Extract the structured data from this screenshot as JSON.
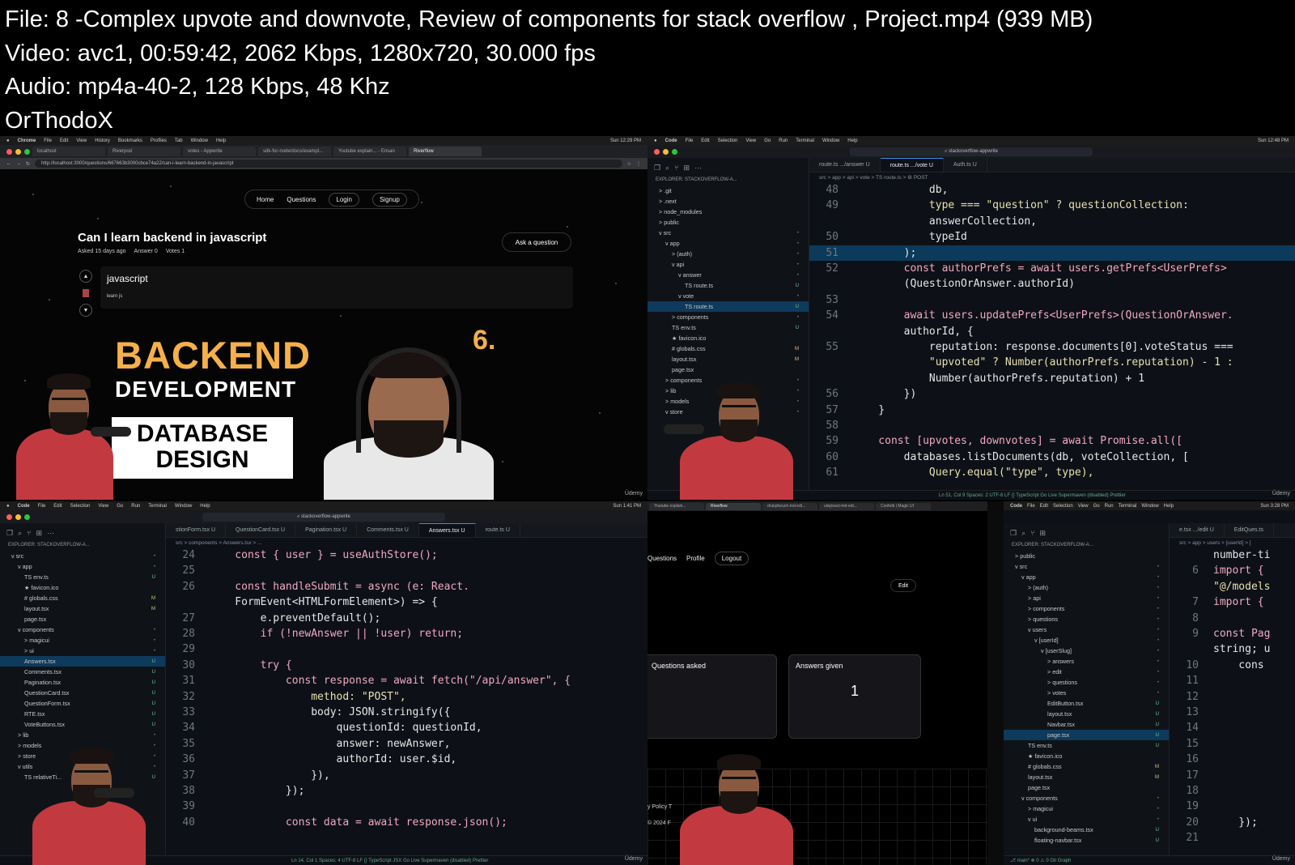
{
  "header": {
    "line1": "File: 8 -Complex upvote and downvote, Review of components for stack overflow , Project.mp4 (939 MB)",
    "line2": "Video: avc1, 00:59:42, 2062 Kbps, 1280x720, 30.000 fps",
    "line3": "Audio: mp4a-40-2, 128 Kbps, 48 Khz",
    "line4": "OrThodoX"
  },
  "watermark": "Ûdemy",
  "q1": {
    "menubar": [
      "Chrome",
      "File",
      "Edit",
      "View",
      "History",
      "Bookmarks",
      "Profiles",
      "Tab",
      "Window",
      "Help"
    ],
    "clock": "Sun 12:29 PM",
    "tabs": [
      "localhost",
      "Riverpod",
      "votes - Appwrite",
      "sdk-for-node/docs/exampl...",
      "Youtube explain... - Ensan",
      "Riverflow"
    ],
    "url": "http://localhost:3000/questions/667663b3000cbce74a22/can-i-learn-backend-in-javascript",
    "nav": {
      "home": "Home",
      "questions": "Questions",
      "login": "Login",
      "signup": "Signup"
    },
    "question_title": "Can I learn backend in javascript",
    "meta": {
      "asked": "Asked 15 days ago",
      "answers": "Answer 0",
      "votes": "Votes 1"
    },
    "ask_button": "Ask a question",
    "answer_title": "javascript",
    "answer_body": "learn js",
    "thumb": {
      "backend": "BACKEND",
      "development": "DEVELOPMENT",
      "database": "DATABASE",
      "design": "DESIGN",
      "number": "6."
    }
  },
  "q2": {
    "menubar": [
      "Code",
      "File",
      "Edit",
      "Selection",
      "View",
      "Go",
      "Run",
      "Terminal",
      "Window",
      "Help"
    ],
    "clock": "Sun 12:48 PM",
    "search": "stackoverflow-appwrite",
    "explorer": "EXPLORER: STACKOVERFLOW-A...",
    "tabs": [
      "route.ts .../answer U",
      "route.ts .../vote U",
      "Auth.ts U"
    ],
    "breadcrumb": "src > app > api > vote > TS route.ts > ⚙ POST",
    "tree": [
      {
        "label": "> .git",
        "indent": 1,
        "status": ""
      },
      {
        "label": "> .next",
        "indent": 1,
        "status": ""
      },
      {
        "label": "> node_modules",
        "indent": 1,
        "status": ""
      },
      {
        "label": "> public",
        "indent": 1,
        "status": ""
      },
      {
        "label": "v src",
        "indent": 1,
        "status": "•"
      },
      {
        "label": "v app",
        "indent": 2,
        "status": "•"
      },
      {
        "label": "> (auth)",
        "indent": 3,
        "status": "•"
      },
      {
        "label": "v api",
        "indent": 3,
        "status": "•"
      },
      {
        "label": "v answer",
        "indent": 4,
        "status": "•"
      },
      {
        "label": "TS route.ts",
        "indent": 5,
        "status": "U"
      },
      {
        "label": "v vote",
        "indent": 4,
        "status": "•"
      },
      {
        "label": "TS route.ts",
        "indent": 5,
        "status": "U",
        "selected": true
      },
      {
        "label": "> components",
        "indent": 3,
        "status": "•"
      },
      {
        "label": "TS env.ts",
        "indent": 3,
        "status": "U"
      },
      {
        "label": "★ favicon.ico",
        "indent": 3,
        "status": ""
      },
      {
        "label": "# globals.css",
        "indent": 3,
        "status": "M"
      },
      {
        "label": "layout.tsx",
        "indent": 3,
        "status": "M"
      },
      {
        "label": "page.tsx",
        "indent": 3,
        "status": ""
      },
      {
        "label": "> components",
        "indent": 2,
        "status": "•"
      },
      {
        "label": "> lib",
        "indent": 2,
        "status": "•"
      },
      {
        "label": "> models",
        "indent": 2,
        "status": "•"
      },
      {
        "label": "v store",
        "indent": 2,
        "status": "•"
      }
    ],
    "lines": [
      {
        "n": "48",
        "t": "            db,"
      },
      {
        "n": "49",
        "t": "            type === \"question\" ? questionCollection:"
      },
      {
        "n": "",
        "t": "            answerCollection,"
      },
      {
        "n": "50",
        "t": "            typeId"
      },
      {
        "n": "51",
        "t": "        );",
        "hl": true
      },
      {
        "n": "52",
        "t": "        const authorPrefs = await users.getPrefs<UserPrefs>"
      },
      {
        "n": "",
        "t": "        (QuestionOrAnswer.authorId)"
      },
      {
        "n": "53",
        "t": ""
      },
      {
        "n": "54",
        "t": "        await users.updatePrefs<UserPrefs>(QuestionOrAnswer."
      },
      {
        "n": "",
        "t": "        authorId, {"
      },
      {
        "n": "55",
        "t": "            reputation: response.documents[0].voteStatus ==="
      },
      {
        "n": "",
        "t": "            \"upvoted\" ? Number(authorPrefs.reputation) - 1 :"
      },
      {
        "n": "",
        "t": "            Number(authorPrefs.reputation) + 1"
      },
      {
        "n": "56",
        "t": "        })"
      },
      {
        "n": "57",
        "t": "    }"
      },
      {
        "n": "58",
        "t": ""
      },
      {
        "n": "59",
        "t": "    const [upvotes, downvotes] = await Promise.all(["
      },
      {
        "n": "60",
        "t": "        databases.listDocuments(db, voteCollection, ["
      },
      {
        "n": "61",
        "t": "            Query.equal(\"type\", type),"
      }
    ],
    "status": "Ln 51, Col 9   Spaces: 2   UTF-8   LF   {} TypeScript   Go Live   Supermaven (disabled)   Prettier"
  },
  "q3": {
    "menubar": [
      "Code",
      "File",
      "Edit",
      "Selection",
      "View",
      "Go",
      "Run",
      "Terminal",
      "Window",
      "Help"
    ],
    "clock": "Sun 1:41 PM",
    "search": "stackoverflow-appwrite",
    "explorer": "EXPLORER: STACKOVERFLOW-A...",
    "tabs": [
      "stionForm.tsx U",
      "QuestionCard.tsx U",
      "Pagination.tsx U",
      "Comments.tsx U",
      "Answers.tsx U",
      "route.ts U"
    ],
    "breadcrumb": "src > components > Answers.tsx > ...",
    "tree": [
      {
        "label": "v src",
        "indent": 1,
        "status": "•"
      },
      {
        "label": "v app",
        "indent": 2,
        "status": "•"
      },
      {
        "label": "TS env.ts",
        "indent": 3,
        "status": "U"
      },
      {
        "label": "★ favicon.ico",
        "indent": 3,
        "status": ""
      },
      {
        "label": "# globals.css",
        "indent": 3,
        "status": "M"
      },
      {
        "label": "layout.tsx",
        "indent": 3,
        "status": "M"
      },
      {
        "label": "page.tsx",
        "indent": 3,
        "status": ""
      },
      {
        "label": "v components",
        "indent": 2,
        "status": "•"
      },
      {
        "label": "> magicui",
        "indent": 3,
        "status": "•"
      },
      {
        "label": "> ui",
        "indent": 3,
        "status": "•"
      },
      {
        "label": "Answers.tsx",
        "indent": 3,
        "status": "U",
        "selected": true
      },
      {
        "label": "Comments.tsx",
        "indent": 3,
        "status": "U"
      },
      {
        "label": "Pagination.tsx",
        "indent": 3,
        "status": "U"
      },
      {
        "label": "QuestionCard.tsx",
        "indent": 3,
        "status": "U"
      },
      {
        "label": "QuestionForm.tsx",
        "indent": 3,
        "status": "U"
      },
      {
        "label": "RTE.tsx",
        "indent": 3,
        "status": "U"
      },
      {
        "label": "VoteButtons.tsx",
        "indent": 3,
        "status": "U"
      },
      {
        "label": "> lib",
        "indent": 2,
        "status": "•"
      },
      {
        "label": "> models",
        "indent": 2,
        "status": "•"
      },
      {
        "label": "> store",
        "indent": 2,
        "status": "•"
      },
      {
        "label": "v utils",
        "indent": 2,
        "status": "•"
      },
      {
        "label": "TS relativeTi...",
        "indent": 3,
        "status": "U"
      }
    ],
    "lines": [
      {
        "n": "24",
        "t": "    const { user } = useAuthStore();"
      },
      {
        "n": "25",
        "t": ""
      },
      {
        "n": "26",
        "t": "    const handleSubmit = async (e: React."
      },
      {
        "n": "",
        "t": "    FormEvent<HTMLFormElement>) => {"
      },
      {
        "n": "27",
        "t": "        e.preventDefault();"
      },
      {
        "n": "28",
        "t": "        if (!newAnswer || !user) return;"
      },
      {
        "n": "29",
        "t": ""
      },
      {
        "n": "30",
        "t": "        try {"
      },
      {
        "n": "31",
        "t": "            const response = await fetch(\"/api/answer\", {"
      },
      {
        "n": "32",
        "t": "                method: \"POST\","
      },
      {
        "n": "33",
        "t": "                body: JSON.stringify({"
      },
      {
        "n": "34",
        "t": "                    questionId: questionId,"
      },
      {
        "n": "35",
        "t": "                    answer: newAnswer,"
      },
      {
        "n": "36",
        "t": "                    authorId: user.$id,"
      },
      {
        "n": "37",
        "t": "                }),"
      },
      {
        "n": "38",
        "t": "            });"
      },
      {
        "n": "39",
        "t": ""
      },
      {
        "n": "40",
        "t": "            const data = await response.json();"
      }
    ],
    "status": "Ln 14, Col 1   Spaces: 4   UTF-8   LF   {} TypeScript JSX   Go Live   Supermaven (disabled)   Prettier"
  },
  "q4": {
    "tabs": [
      "Youtube explain...",
      "Riverflow",
      "drukpheuch-md-edi...",
      "uiwjreact-md-edi...",
      "Confetti | Magic UI"
    ],
    "nav": {
      "questions": "Questions",
      "profile": "Profile",
      "logout": "Logout"
    },
    "edit": "Edit",
    "cards": [
      {
        "label": "Questions asked",
        "value": ""
      },
      {
        "label": "Answers given",
        "value": "1"
      }
    ],
    "footer_policy": "y Policy  T",
    "footer_copy": "© 2024 F",
    "menubar": [
      "Code",
      "File",
      "Edit",
      "Selection",
      "View",
      "Go",
      "Run",
      "Terminal",
      "Window",
      "Help"
    ],
    "clock": "Sun 3:28 PM",
    "explorer": "EXPLORER: STACKOVERFLOW-A...",
    "tabs_right": [
      "e.tsx .../edit U",
      "EditQues.ts"
    ],
    "breadcrumb": "src > app > users > [userId] > [",
    "tree": [
      {
        "label": "> public",
        "indent": 1,
        "status": ""
      },
      {
        "label": "v src",
        "indent": 1,
        "status": "•"
      },
      {
        "label": "v app",
        "indent": 2,
        "status": "•"
      },
      {
        "label": "> (auth)",
        "indent": 3,
        "status": "•"
      },
      {
        "label": "> api",
        "indent": 3,
        "status": "•"
      },
      {
        "label": "> components",
        "indent": 3,
        "status": "•"
      },
      {
        "label": "> questions",
        "indent": 3,
        "status": "•"
      },
      {
        "label": "v users",
        "indent": 3,
        "status": "•"
      },
      {
        "label": "v [userId]",
        "indent": 4,
        "status": "•"
      },
      {
        "label": "v [userSlug]",
        "indent": 5,
        "status": "•"
      },
      {
        "label": "> answers",
        "indent": 6,
        "status": "•"
      },
      {
        "label": "> edit",
        "indent": 6,
        "status": "•"
      },
      {
        "label": "> questions",
        "indent": 6,
        "status": "•"
      },
      {
        "label": "> votes",
        "indent": 6,
        "status": "•"
      },
      {
        "label": "EditButton.tsx",
        "indent": 6,
        "status": "U"
      },
      {
        "label": "layout.tsx",
        "indent": 6,
        "status": "U"
      },
      {
        "label": "Navbar.tsx",
        "indent": 6,
        "status": "U"
      },
      {
        "label": "page.tsx",
        "indent": 6,
        "status": "U",
        "selected": true
      },
      {
        "label": "TS env.ts",
        "indent": 3,
        "status": "U"
      },
      {
        "label": "★ favicon.ico",
        "indent": 3,
        "status": ""
      },
      {
        "label": "# globals.css",
        "indent": 3,
        "status": "M"
      },
      {
        "label": "layout.tsx",
        "indent": 3,
        "status": "M"
      },
      {
        "label": "page.tsx",
        "indent": 3,
        "status": ""
      },
      {
        "label": "v components",
        "indent": 2,
        "status": "•"
      },
      {
        "label": "> magicui",
        "indent": 3,
        "status": "•"
      },
      {
        "label": "v ui",
        "indent": 3,
        "status": "•"
      },
      {
        "label": "background-beams.tsx",
        "indent": 4,
        "status": "U"
      },
      {
        "label": "floating-navbar.tsx",
        "indent": 4,
        "status": "U"
      }
    ],
    "lines": [
      {
        "n": "",
        "t": "number-ti"
      },
      {
        "n": "6",
        "t": "import {"
      },
      {
        "n": "",
        "t": "\"@/models"
      },
      {
        "n": "7",
        "t": "import {"
      },
      {
        "n": "8",
        "t": ""
      },
      {
        "n": "9",
        "t": "const Pag"
      },
      {
        "n": "",
        "t": "string; u"
      },
      {
        "n": "10",
        "t": "    cons"
      },
      {
        "n": "11",
        "t": ""
      },
      {
        "n": "12",
        "t": ""
      },
      {
        "n": "13",
        "t": ""
      },
      {
        "n": "14",
        "t": ""
      },
      {
        "n": "15",
        "t": ""
      },
      {
        "n": "16",
        "t": ""
      },
      {
        "n": "17",
        "t": ""
      },
      {
        "n": "18",
        "t": ""
      },
      {
        "n": "19",
        "t": ""
      },
      {
        "n": "20",
        "t": "    });"
      },
      {
        "n": "21",
        "t": ""
      }
    ],
    "status": "⎇ main*   ⊗ 0 ⚠ 0   Git Graph"
  }
}
